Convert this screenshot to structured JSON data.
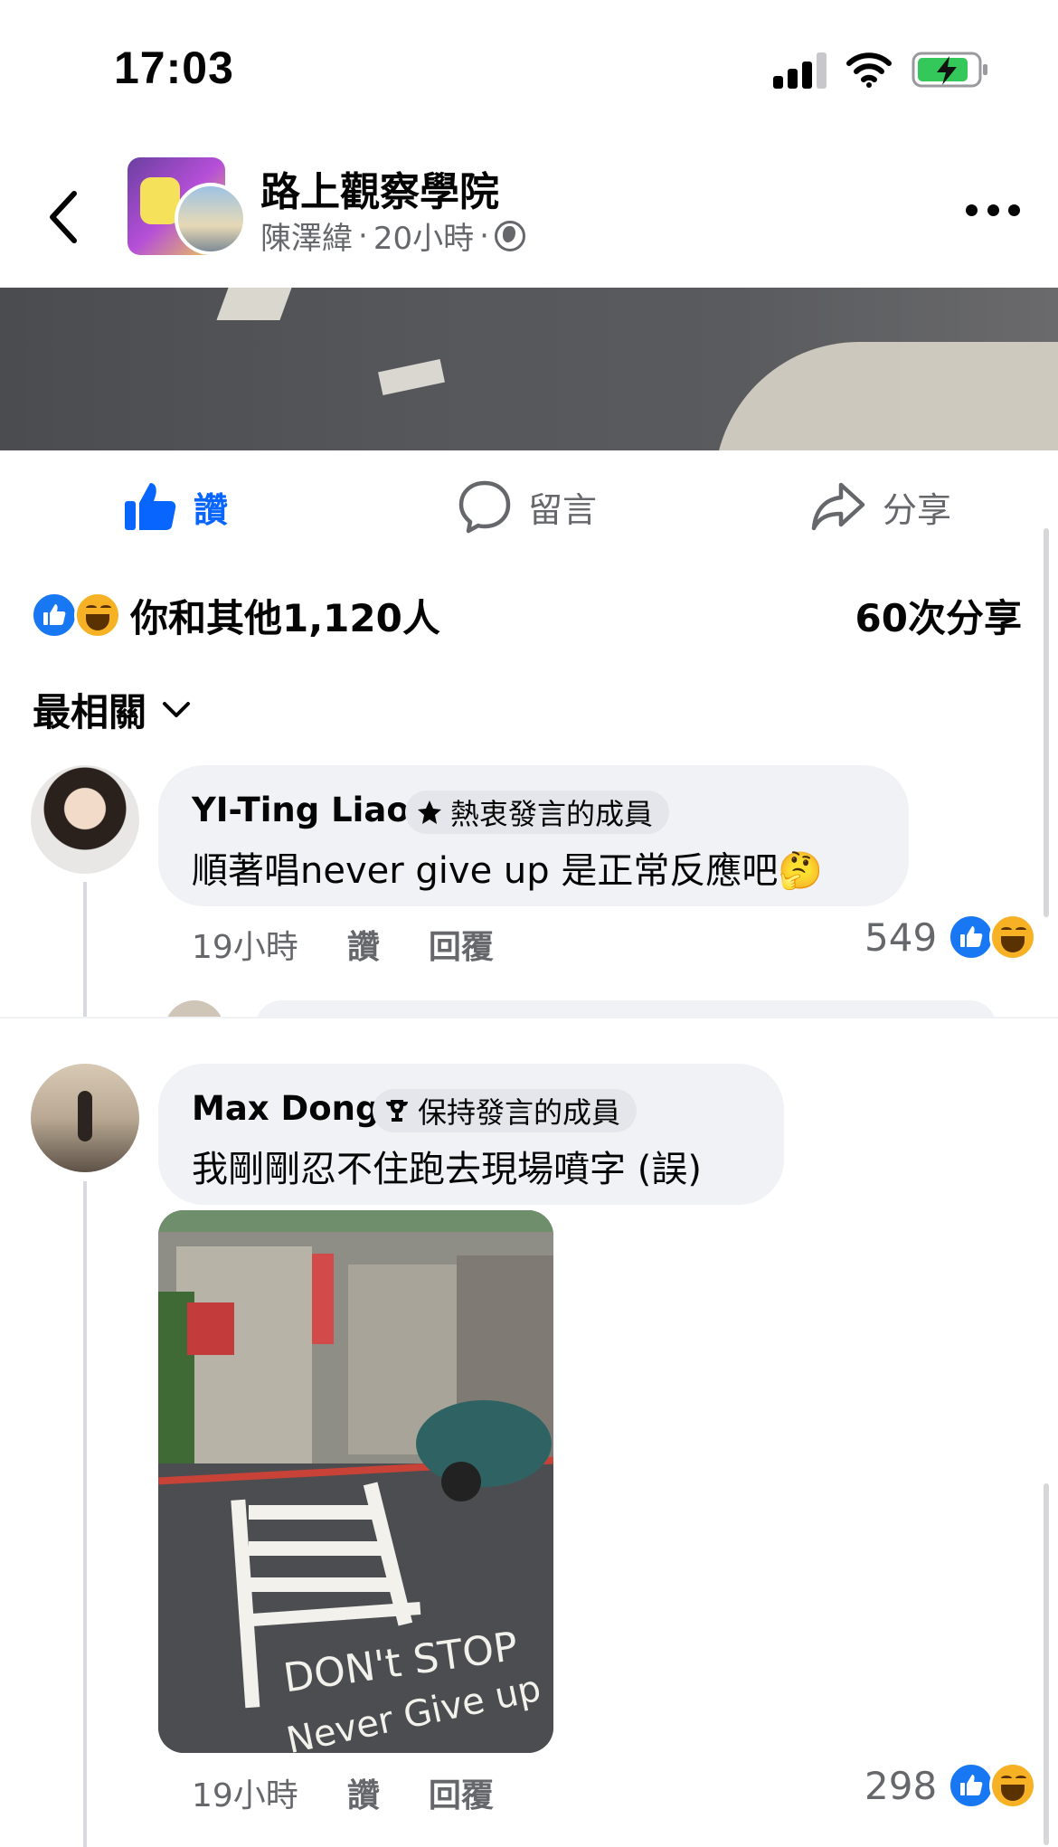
{
  "status_bar": {
    "time": "17:03"
  },
  "post": {
    "group_name": "路上觀察學院",
    "author": "陳澤緯",
    "separator": "·",
    "time_ago": "20小時",
    "actions": {
      "like": "讚",
      "comment": "留言",
      "share": "分享"
    },
    "reactions_text": "你和其他1,120人",
    "shares_text": "60次分享"
  },
  "sort": {
    "label": "最相關"
  },
  "comments": [
    {
      "name": "YI-Ting Liao",
      "badge": "熱衷發言的成員",
      "text": "順著唱never give up 是正常反應吧",
      "emoji": "🤔",
      "time": "19小時",
      "like": "讚",
      "reply": "回覆",
      "reaction_count": "549"
    },
    {
      "name": "Max Dong",
      "badge": "保持發言的成員",
      "text": "我剛剛忍不住跑去現場噴字 (誤)",
      "photo_text_line1": "DON't STOP",
      "photo_text_line2": "Never Give up",
      "time": "19小時",
      "like": "讚",
      "reply": "回覆",
      "reaction_count": "298"
    }
  ],
  "colors": {
    "accent": "#0866ff",
    "secondary_text": "#65676b",
    "bubble": "#f0f2f5"
  },
  "icons": [
    "chevron-left-icon",
    "more-icon",
    "globe-icon",
    "like-icon",
    "comment-icon",
    "share-icon",
    "star-icon",
    "trophy-icon",
    "chevron-down-icon"
  ]
}
